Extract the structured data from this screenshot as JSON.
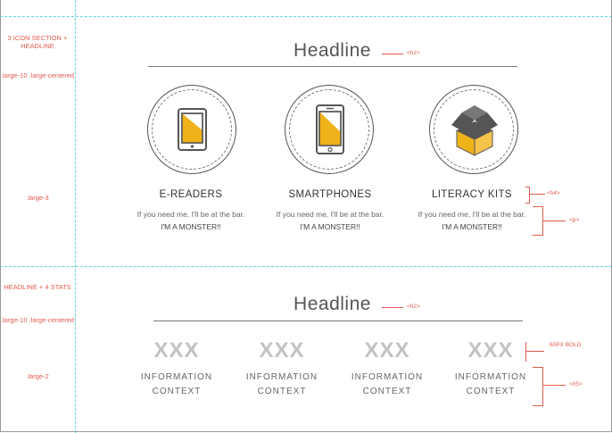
{
  "section1": {
    "side_label": "3 ICON SECTION + HEADLINE",
    "grid_label": ".large-10 .large-centered",
    "column_label": ".large-3",
    "headline": "Headline",
    "headline_tag": "<h2>",
    "title_tag": "<h4>",
    "desc_tag": "<p>",
    "items": [
      {
        "title": "E-READERS",
        "line1": "If you need me, I'll be at the bar.",
        "line2": "I'M A MONSTER!!",
        "icon": "tablet-icon"
      },
      {
        "title": "SMARTPHONES",
        "line1": "If you need me, I'll be at the bar.",
        "line2": "I'M A MONSTER!!",
        "icon": "smartphone-icon"
      },
      {
        "title": "LITERACY KITS",
        "line1": "If you need me, I'll be at the bar.",
        "line2": "I'M A MONSTER!!",
        "icon": "box-icon"
      }
    ]
  },
  "section2": {
    "side_label": "HEADLINE + 4 STATS",
    "grid_label": ".large-10 .large-centered",
    "column_label": ".large-2",
    "headline": "Headline",
    "headline_tag": "<h2>",
    "num_tag": "60PX BOLD",
    "label_tag": "<h5>",
    "stats": [
      {
        "value": "XXX",
        "line1": "INFORMATION",
        "line2": "CONTEXT"
      },
      {
        "value": "XXX",
        "line1": "INFORMATION",
        "line2": "CONTEXT"
      },
      {
        "value": "XXX",
        "line1": "INFORMATION",
        "line2": "CONTEXT"
      },
      {
        "value": "XXX",
        "line1": "INFORMATION",
        "line2": "CONTEXT"
      }
    ]
  },
  "colors": {
    "accent": "#f0b21b",
    "annotation": "#e25b4f",
    "guide": "#5fd6da"
  }
}
